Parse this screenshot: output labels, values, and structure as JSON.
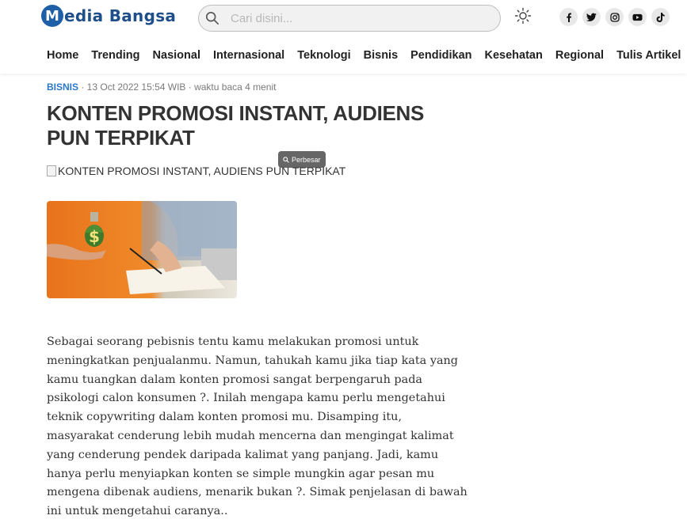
{
  "site": {
    "logo_letter": "M",
    "logo_text": "edia Bangsa",
    "brand_color": "#1e5fa8"
  },
  "search": {
    "placeholder": "Cari disini..."
  },
  "socials": [
    {
      "name": "facebook-icon",
      "glyph": "f"
    },
    {
      "name": "twitter-icon",
      "glyph": "t"
    },
    {
      "name": "instagram-icon",
      "glyph": "ig"
    },
    {
      "name": "youtube-icon",
      "glyph": "yt"
    },
    {
      "name": "tiktok-icon",
      "glyph": "tt"
    }
  ],
  "nav": {
    "items": [
      "Home",
      "Trending",
      "Nasional",
      "Internasional",
      "Teknologi",
      "Bisnis",
      "Pendidikan",
      "Kesehatan",
      "Regional",
      "Tulis Artikel"
    ]
  },
  "article": {
    "category": "BISNIS",
    "meta": " · 13 Oct 2022 15:54 WIB · waktu baca 4 menit",
    "title": "KONTEN PROMOSI INSTANT, AUDIENS PUN TERPIKAT",
    "enlarge_label": "Perbesar",
    "image_alt": "KONTEN PROMOSI INSTANT, AUDIENS PUN TERPIKAT",
    "body": "Sebagai seorang pebisnis tentu kamu melakukan promosi untuk meningkatkan penjualanmu. Namun, tahukah kamu jika tiap kata yang kamu tuangkan dalam konten promosi sangat berpengaruh pada psikologi calon konsumen ?. Inilah mengapa kamu perlu mengetahui teknik copywriting dalam konten promosi mu. Disamping itu, masyarakat cenderung lebih mudah mencerna dan mengingat kalimat yang cenderung pendek daripada kalimat yang panjang. Jadi, kamu hanya perlu menyiapkan konten se simple mungkin agar pesan mu mengena dibenak audiens, menarik bukan ?. Simak penjelasan di bawah ini untuk mengetahui caranya..",
    "accent_color": "#2b77c7"
  }
}
